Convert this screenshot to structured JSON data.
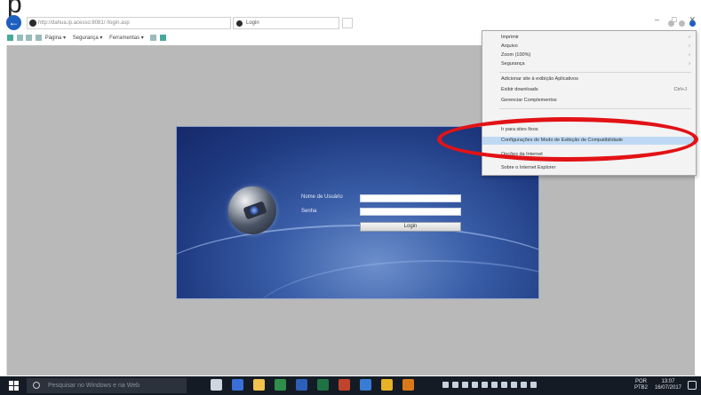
{
  "caption": {
    "text": "p"
  },
  "browser": {
    "address": "http://dahua.ip.acesso:8081/ /login.asp",
    "tab_title": "Login",
    "window_controls": [
      "–",
      "□",
      "✕"
    ],
    "command_bar": [
      "Página ▾",
      "Segurança ▾",
      "Ferramentas ▾"
    ]
  },
  "login": {
    "username_label": "Nome de Usuário",
    "password_label": "Senha",
    "login_button": "Login"
  },
  "tools_menu": {
    "items": [
      {
        "label": "Imprimir",
        "submenu": true
      },
      {
        "label": "Arquivo",
        "submenu": true
      },
      {
        "label": "Zoom (100%)",
        "submenu": true
      },
      {
        "label": "Segurança",
        "submenu": true
      },
      {
        "label": "Adicionar site à exibição Aplicativos"
      },
      {
        "label": "Exibir downloads",
        "shortcut": "Ctrl+J"
      },
      {
        "label": "Gerenciar Complementos"
      },
      {
        "label": "Ir para sites fixos"
      },
      {
        "label": "Configurações do Modo de Exibição de Compatibilidade",
        "highlighted": true
      },
      {
        "label": "Opções da Internet"
      },
      {
        "label": "Sobre o Internet Explorer"
      }
    ]
  },
  "taskbar": {
    "search_placeholder": "Pesquisar no Windows e na Web",
    "language": "POR",
    "language_sub": "PTB2",
    "time": "13:07",
    "date": "16/07/2017"
  },
  "colors": {
    "highlight_ring": "#e21216",
    "menu_highlight": "#bfd9f4",
    "taskbar": "#141b24",
    "login_panel": "#1f3b82"
  }
}
